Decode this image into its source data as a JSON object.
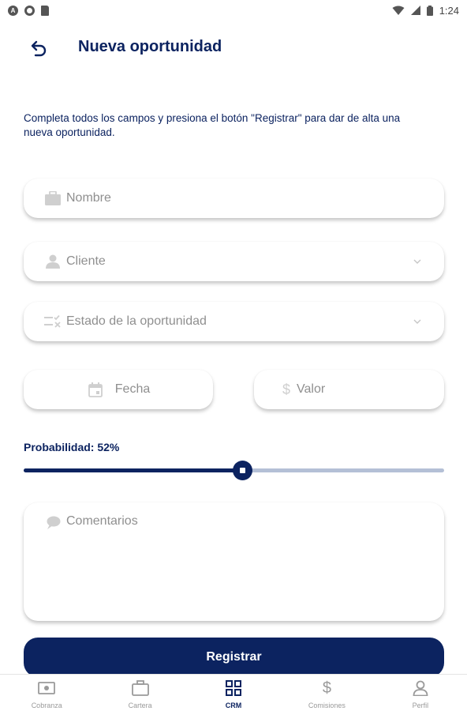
{
  "status_bar": {
    "time": "1:24"
  },
  "header": {
    "title": "Nueva oportunidad"
  },
  "intro": "Completa todos los campos y presiona el botón \"Registrar\" para dar de alta una nueva oportunidad.",
  "form": {
    "nombre_placeholder": "Nombre",
    "cliente_placeholder": "Cliente",
    "estado_placeholder": "Estado de la oportunidad",
    "fecha_placeholder": "Fecha",
    "valor_placeholder": "Valor",
    "probabilidad_label": "Probabilidad: 52%",
    "probabilidad_value": 52,
    "comentarios_placeholder": "Comentarios",
    "submit_label": "Registrar"
  },
  "nav": {
    "items": [
      {
        "label": "Cobranza",
        "icon": "cash-icon"
      },
      {
        "label": "Cartera",
        "icon": "briefcase-icon"
      },
      {
        "label": "CRM",
        "icon": "grid-icon",
        "active": true
      },
      {
        "label": "Comisiones",
        "icon": "dollar-icon"
      },
      {
        "label": "Perfil",
        "icon": "person-icon"
      }
    ]
  },
  "colors": {
    "primary": "#0c2360",
    "track": "#b4c0d6",
    "placeholder": "#8f8f8f"
  }
}
